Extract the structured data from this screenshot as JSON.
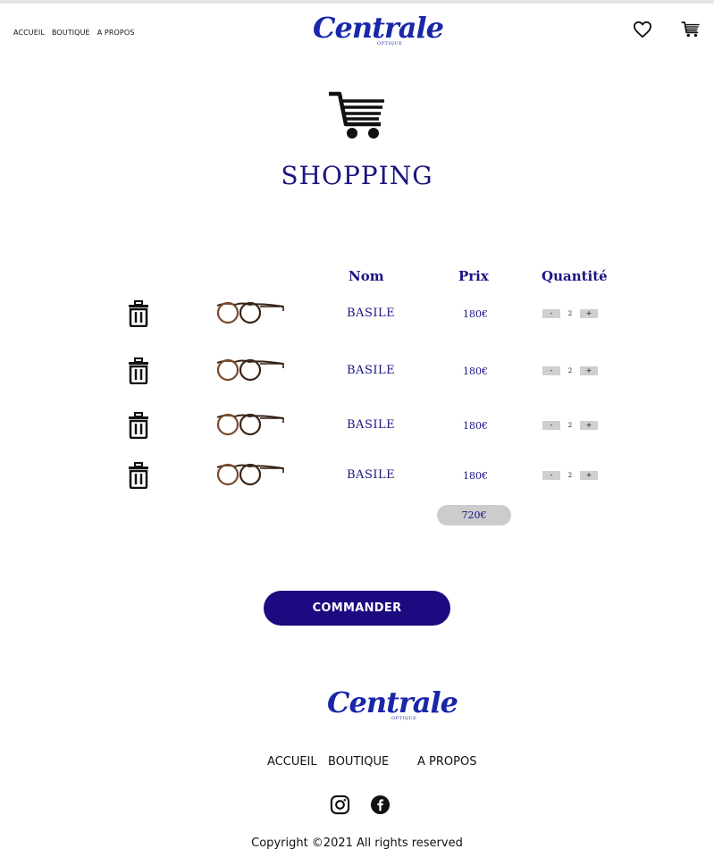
{
  "header": {
    "nav": [
      "ACCUEIL",
      "BOUTIQUE",
      "A PROPOS"
    ],
    "logo_text": "Centrale",
    "logo_sub": "OPTIQUE",
    "icons": [
      "heart-icon",
      "cart-icon"
    ]
  },
  "page": {
    "title": "SHOPPING",
    "hero_icon": "cart-icon"
  },
  "table": {
    "headers": {
      "name": "Nom",
      "price": "Prix",
      "quantity": "Quantité"
    },
    "rows": [
      {
        "name": "BASILE",
        "price": "180€",
        "qty": "2"
      },
      {
        "name": "BASILE",
        "price": "180€",
        "qty": "2"
      },
      {
        "name": "BASILE",
        "price": "180€",
        "qty": "2"
      },
      {
        "name": "BASILE",
        "price": "180€",
        "qty": "2"
      }
    ],
    "minus_label": "-",
    "plus_label": "+",
    "total": "720€"
  },
  "actions": {
    "order_label": "COMMANDER"
  },
  "footer": {
    "logo_text": "Centrale",
    "logo_sub": "OPTIQUE",
    "nav": [
      "ACCUEIL",
      "BOUTIQUE",
      "A PROPOS"
    ],
    "social": [
      "instagram-icon",
      "facebook-icon"
    ],
    "copyright": "Copyright ©2021 All rights reserved"
  },
  "colors": {
    "accent": "#1a1480",
    "button": "#1c0a80",
    "logo": "#1a27a8",
    "total_bg": "#cccccc"
  }
}
